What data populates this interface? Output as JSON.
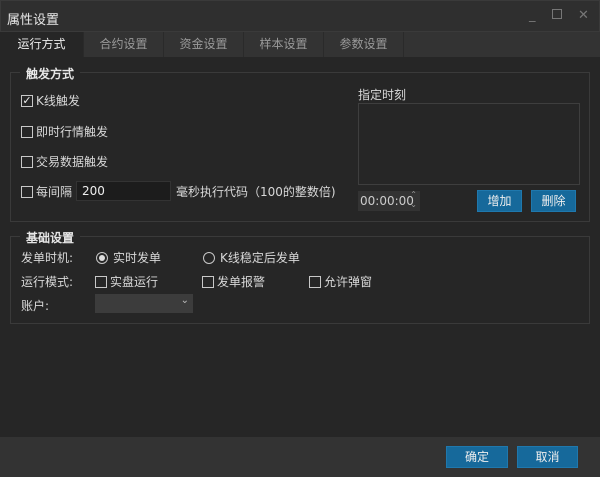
{
  "window": {
    "title": "属性设置"
  },
  "tabs": [
    {
      "label": "运行方式"
    },
    {
      "label": "合约设置"
    },
    {
      "label": "资金设置"
    },
    {
      "label": "样本设置"
    },
    {
      "label": "参数设置"
    }
  ],
  "trigger": {
    "title": "触发方式",
    "kline": {
      "label": "K线触发",
      "checked": true
    },
    "realtime": {
      "label": "即时行情触发",
      "checked": false
    },
    "trade": {
      "label": "交易数据触发",
      "checked": false
    },
    "interval": {
      "label": "每间隔",
      "value": "200",
      "suffix": "毫秒执行代码（100的整数倍)",
      "checked": false
    },
    "time": {
      "label": "指定时刻",
      "value": "00:00:00",
      "add": "增加",
      "delete": "删除"
    }
  },
  "basic": {
    "title": "基础设置",
    "order_timing": {
      "label": "发单时机:",
      "options": [
        "实时发单",
        "K线稳定后发单"
      ],
      "selected": 0
    },
    "run_mode": {
      "label": "运行模式:",
      "options": [
        {
          "label": "实盘运行",
          "checked": false
        },
        {
          "label": "发单报警",
          "checked": false
        },
        {
          "label": "允许弹窗",
          "checked": false
        }
      ]
    },
    "account": {
      "label": "账户:",
      "value": ""
    }
  },
  "footer": {
    "ok": "确定",
    "cancel": "取消"
  },
  "colors": {
    "accent": "#16699b",
    "background": "#262626"
  }
}
